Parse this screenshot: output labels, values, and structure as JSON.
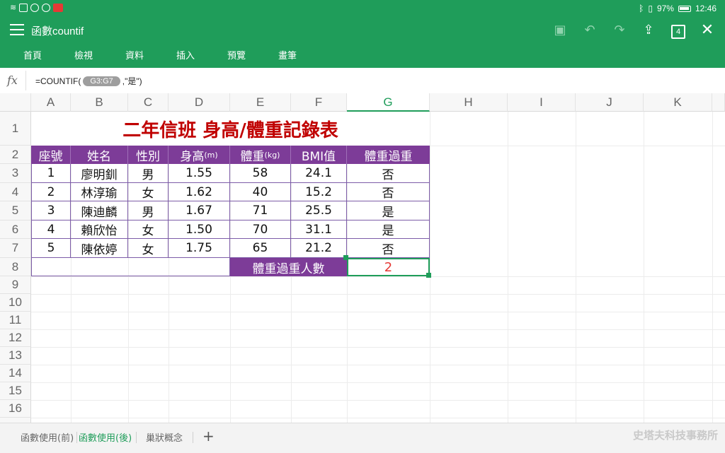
{
  "status": {
    "battery": "97%",
    "time": "12:46"
  },
  "title": "函數countif",
  "ribbon_tabs": [
    "首頁",
    "檢視",
    "資料",
    "插入",
    "預覽",
    "畫筆"
  ],
  "toolbar": {
    "tab_count": "4"
  },
  "formula": {
    "fx": "fx",
    "prefix": "=COUNTIF(",
    "range": "G3:G7",
    "suffix": ",\"是\")"
  },
  "columns": [
    "A",
    "B",
    "C",
    "D",
    "E",
    "F",
    "G",
    "H",
    "I",
    "J",
    "K"
  ],
  "rows": [
    "1",
    "2",
    "3",
    "4",
    "5",
    "6",
    "7",
    "8",
    "9",
    "10",
    "11",
    "12",
    "13",
    "14",
    "15",
    "16"
  ],
  "sheet": {
    "title": "二年信班 身高/體重記錄表",
    "headers": [
      "座號",
      "姓名",
      "性別",
      "身高",
      "體重",
      "BMI值",
      "體重過重"
    ],
    "height_unit": "(m)",
    "weight_unit": "(kg)",
    "data": [
      [
        "1",
        "廖明釧",
        "男",
        "1.55",
        "58",
        "24.1",
        "否"
      ],
      [
        "2",
        "林淳瑜",
        "女",
        "1.62",
        "40",
        "15.2",
        "否"
      ],
      [
        "3",
        "陳迪麟",
        "男",
        "1.67",
        "71",
        "25.5",
        "是"
      ],
      [
        "4",
        "賴欣怡",
        "女",
        "1.50",
        "70",
        "31.1",
        "是"
      ],
      [
        "5",
        "陳依婷",
        "女",
        "1.75",
        "65",
        "21.2",
        "否"
      ]
    ],
    "summary_label": "體重過重人數",
    "summary_value": "2"
  },
  "sheet_tabs": [
    "函數使用(前)",
    "函數使用(後)",
    "巢狀概念"
  ],
  "add_sheet": "+",
  "watermark": "史塔夫科技事務所"
}
